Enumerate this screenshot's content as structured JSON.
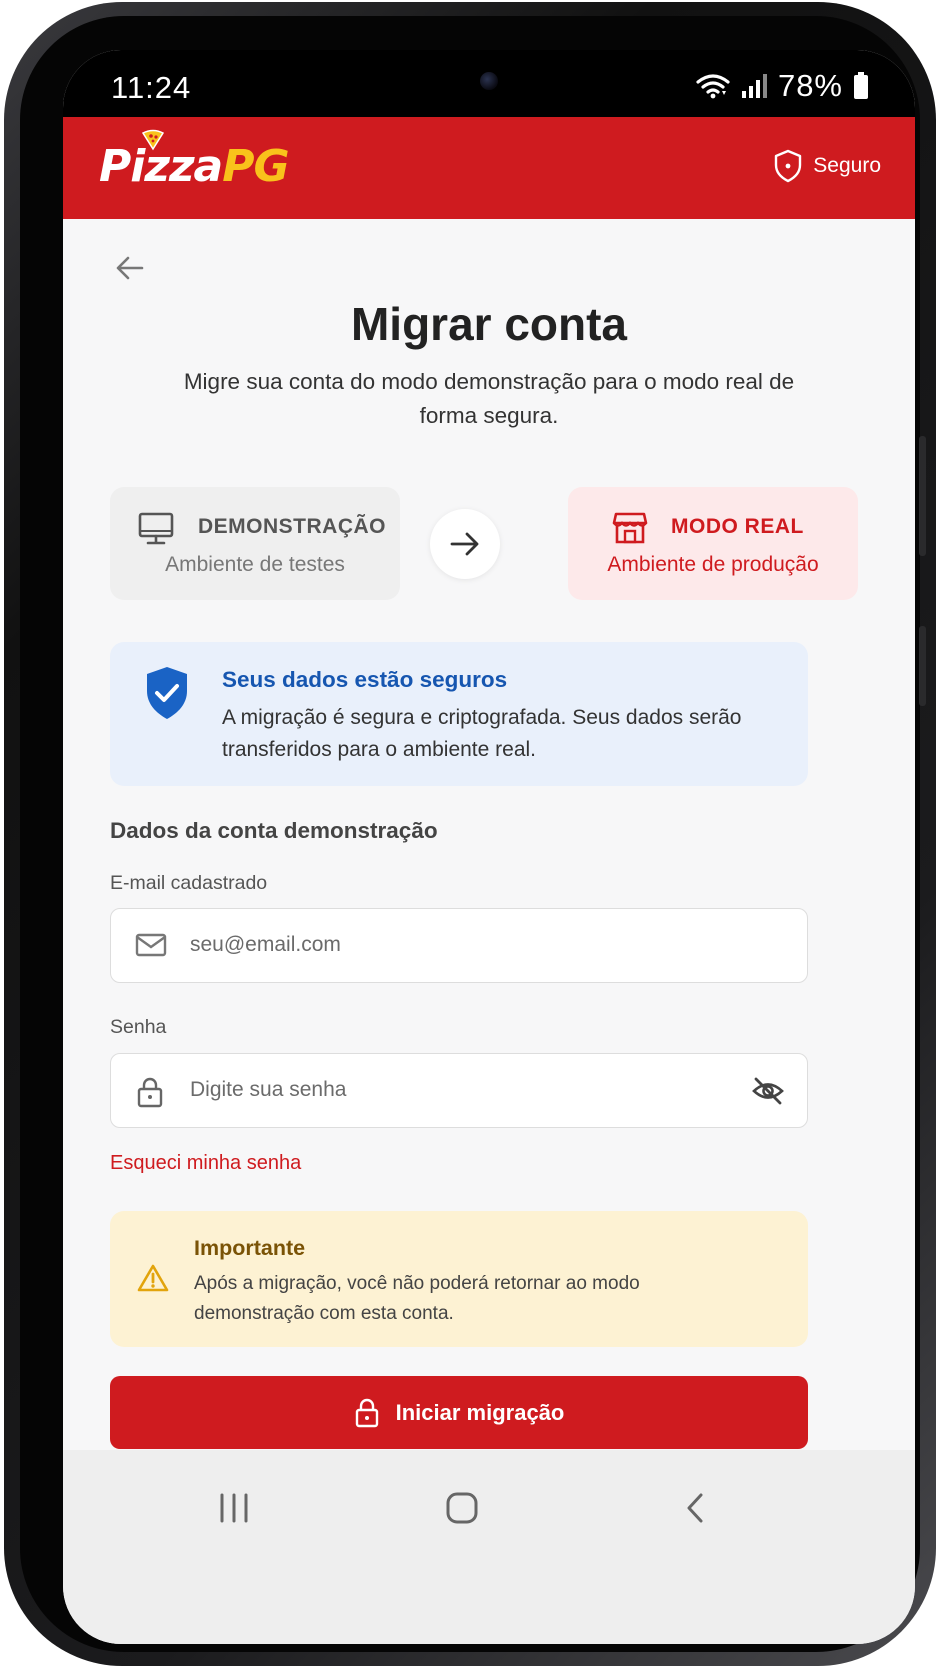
{
  "status_bar": {
    "time": "11:24",
    "battery_percent": "78%",
    "icons": [
      "wifi-icon",
      "signal-icon",
      "battery-icon"
    ]
  },
  "header": {
    "logo_part1": "Pizza",
    "logo_part2": "PG",
    "secure_label": "Seguro",
    "brand_color": "#cf1b1f",
    "accent_color": "#f9c21b"
  },
  "page": {
    "title": "Migrar conta",
    "subtitle": "Migre sua conta do modo demonstração para o modo real de forma segura."
  },
  "modes": {
    "from": {
      "title": "DEMONSTRAÇÃO",
      "subtitle": "Ambiente de testes",
      "icon": "monitor-icon"
    },
    "to": {
      "title": "MODO REAL",
      "subtitle": "Ambiente de produção",
      "icon": "store-icon"
    }
  },
  "security_notice": {
    "title": "Seus dados estão seguros",
    "text": "A migração é segura e criptografada. Seus dados serão transferidos para o ambiente real."
  },
  "form": {
    "section_title": "Dados da conta demonstração",
    "email_label": "E-mail cadastrado",
    "email_placeholder": "seu@email.com",
    "password_label": "Senha",
    "password_placeholder": "Digite sua senha",
    "forgot_password": "Esqueci minha senha"
  },
  "warning": {
    "title": "Importante",
    "text": "Após a migração, você não poderá retornar ao modo demonstração com esta conta."
  },
  "cta": {
    "label": "Iniciar migração"
  },
  "system_nav": [
    "recents-button",
    "home-button",
    "back-button"
  ]
}
